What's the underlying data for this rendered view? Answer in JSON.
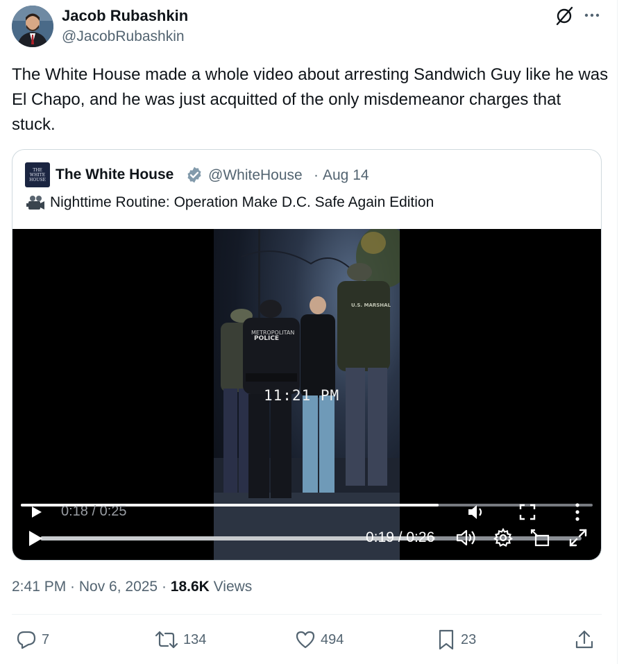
{
  "author": {
    "name": "Jacob Rubashkin",
    "handle": "@JacobRubashkin"
  },
  "tweet": {
    "text": "The White House made a whole video about arresting Sandwich Guy like he was El Chapo, and he was just acquitted of the only misdemeanor charges that stuck."
  },
  "quoted": {
    "avatar_text": "THE WHITE HOUSE",
    "name": "The White House",
    "handle": "@WhiteHouse",
    "separator": "·",
    "date": "Aug 14",
    "text": "Nighttime Routine: Operation Make D.C. Safe Again Edition",
    "video": {
      "overlay_text": "11:21 PM",
      "patch_text_1": "METROPOLITAN",
      "patch_text_2": "POLICE",
      "patch_text_3": "U.S. MARSHAL",
      "ghost_time": "0:18 / 0:25",
      "ghost_progress": 0.73,
      "time": "0:19 / 0:26",
      "progress": 0.73
    }
  },
  "meta": {
    "time": "2:41 PM · Nov 6, 2025 · ",
    "views_count": "18.6K",
    "views_label": " Views"
  },
  "actions": {
    "replies": "7",
    "reposts": "134",
    "likes": "494",
    "bookmarks": "23"
  },
  "icons": [
    "grok-icon",
    "more-icon",
    "verified-icon",
    "camera-icon",
    "play-icon",
    "volume-icon",
    "fullscreen-icon",
    "more-vertical-icon",
    "settings-icon",
    "picture-in-picture-icon",
    "expand-icon",
    "reply-icon",
    "repost-icon",
    "like-icon",
    "bookmark-icon",
    "share-icon"
  ],
  "colors": {
    "text": "#0f1419",
    "secondary": "#536471",
    "border": "#cfd9de",
    "verified": "#829aab"
  }
}
